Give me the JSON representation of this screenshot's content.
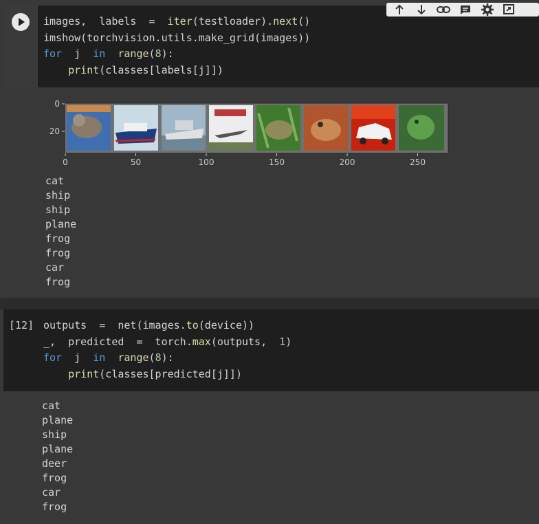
{
  "cell1": {
    "lines": [
      "images,  labels  =  iter(testloader).next()",
      "imshow(torchvision.utils.make_grid(images))",
      "for  j  in  range(8):",
      "    print(classes[labels[j]])"
    ],
    "output_lines": [
      "cat",
      "ship",
      "ship",
      "plane",
      "frog",
      "frog",
      "car",
      "frog"
    ]
  },
  "plot": {
    "x_ticks": [
      "0",
      "50",
      "100",
      "150",
      "200",
      "250"
    ],
    "y_ticks": [
      "0",
      "20"
    ]
  },
  "cell2": {
    "exec_count": "[12]",
    "lines": [
      "outputs  =  net(images.to(device))",
      "_,  predicted  =  torch.max(outputs,  1)",
      "for  j  in  range(8):",
      "    print(classes[predicted[j]])"
    ],
    "output_lines": [
      "cat",
      "plane",
      "ship",
      "plane",
      "deer",
      "frog",
      "car",
      "frog"
    ]
  },
  "toolbar": [
    "arrow-up-icon",
    "arrow-down-icon",
    "link-icon",
    "comment-icon",
    "gear-icon",
    "open-in-icon"
  ],
  "colors": {
    "code_bg": "#1e1e1e",
    "output_bg": "#383838",
    "keyword": "#569cd6",
    "function": "#dcdcaa",
    "number": "#b5cea8"
  }
}
